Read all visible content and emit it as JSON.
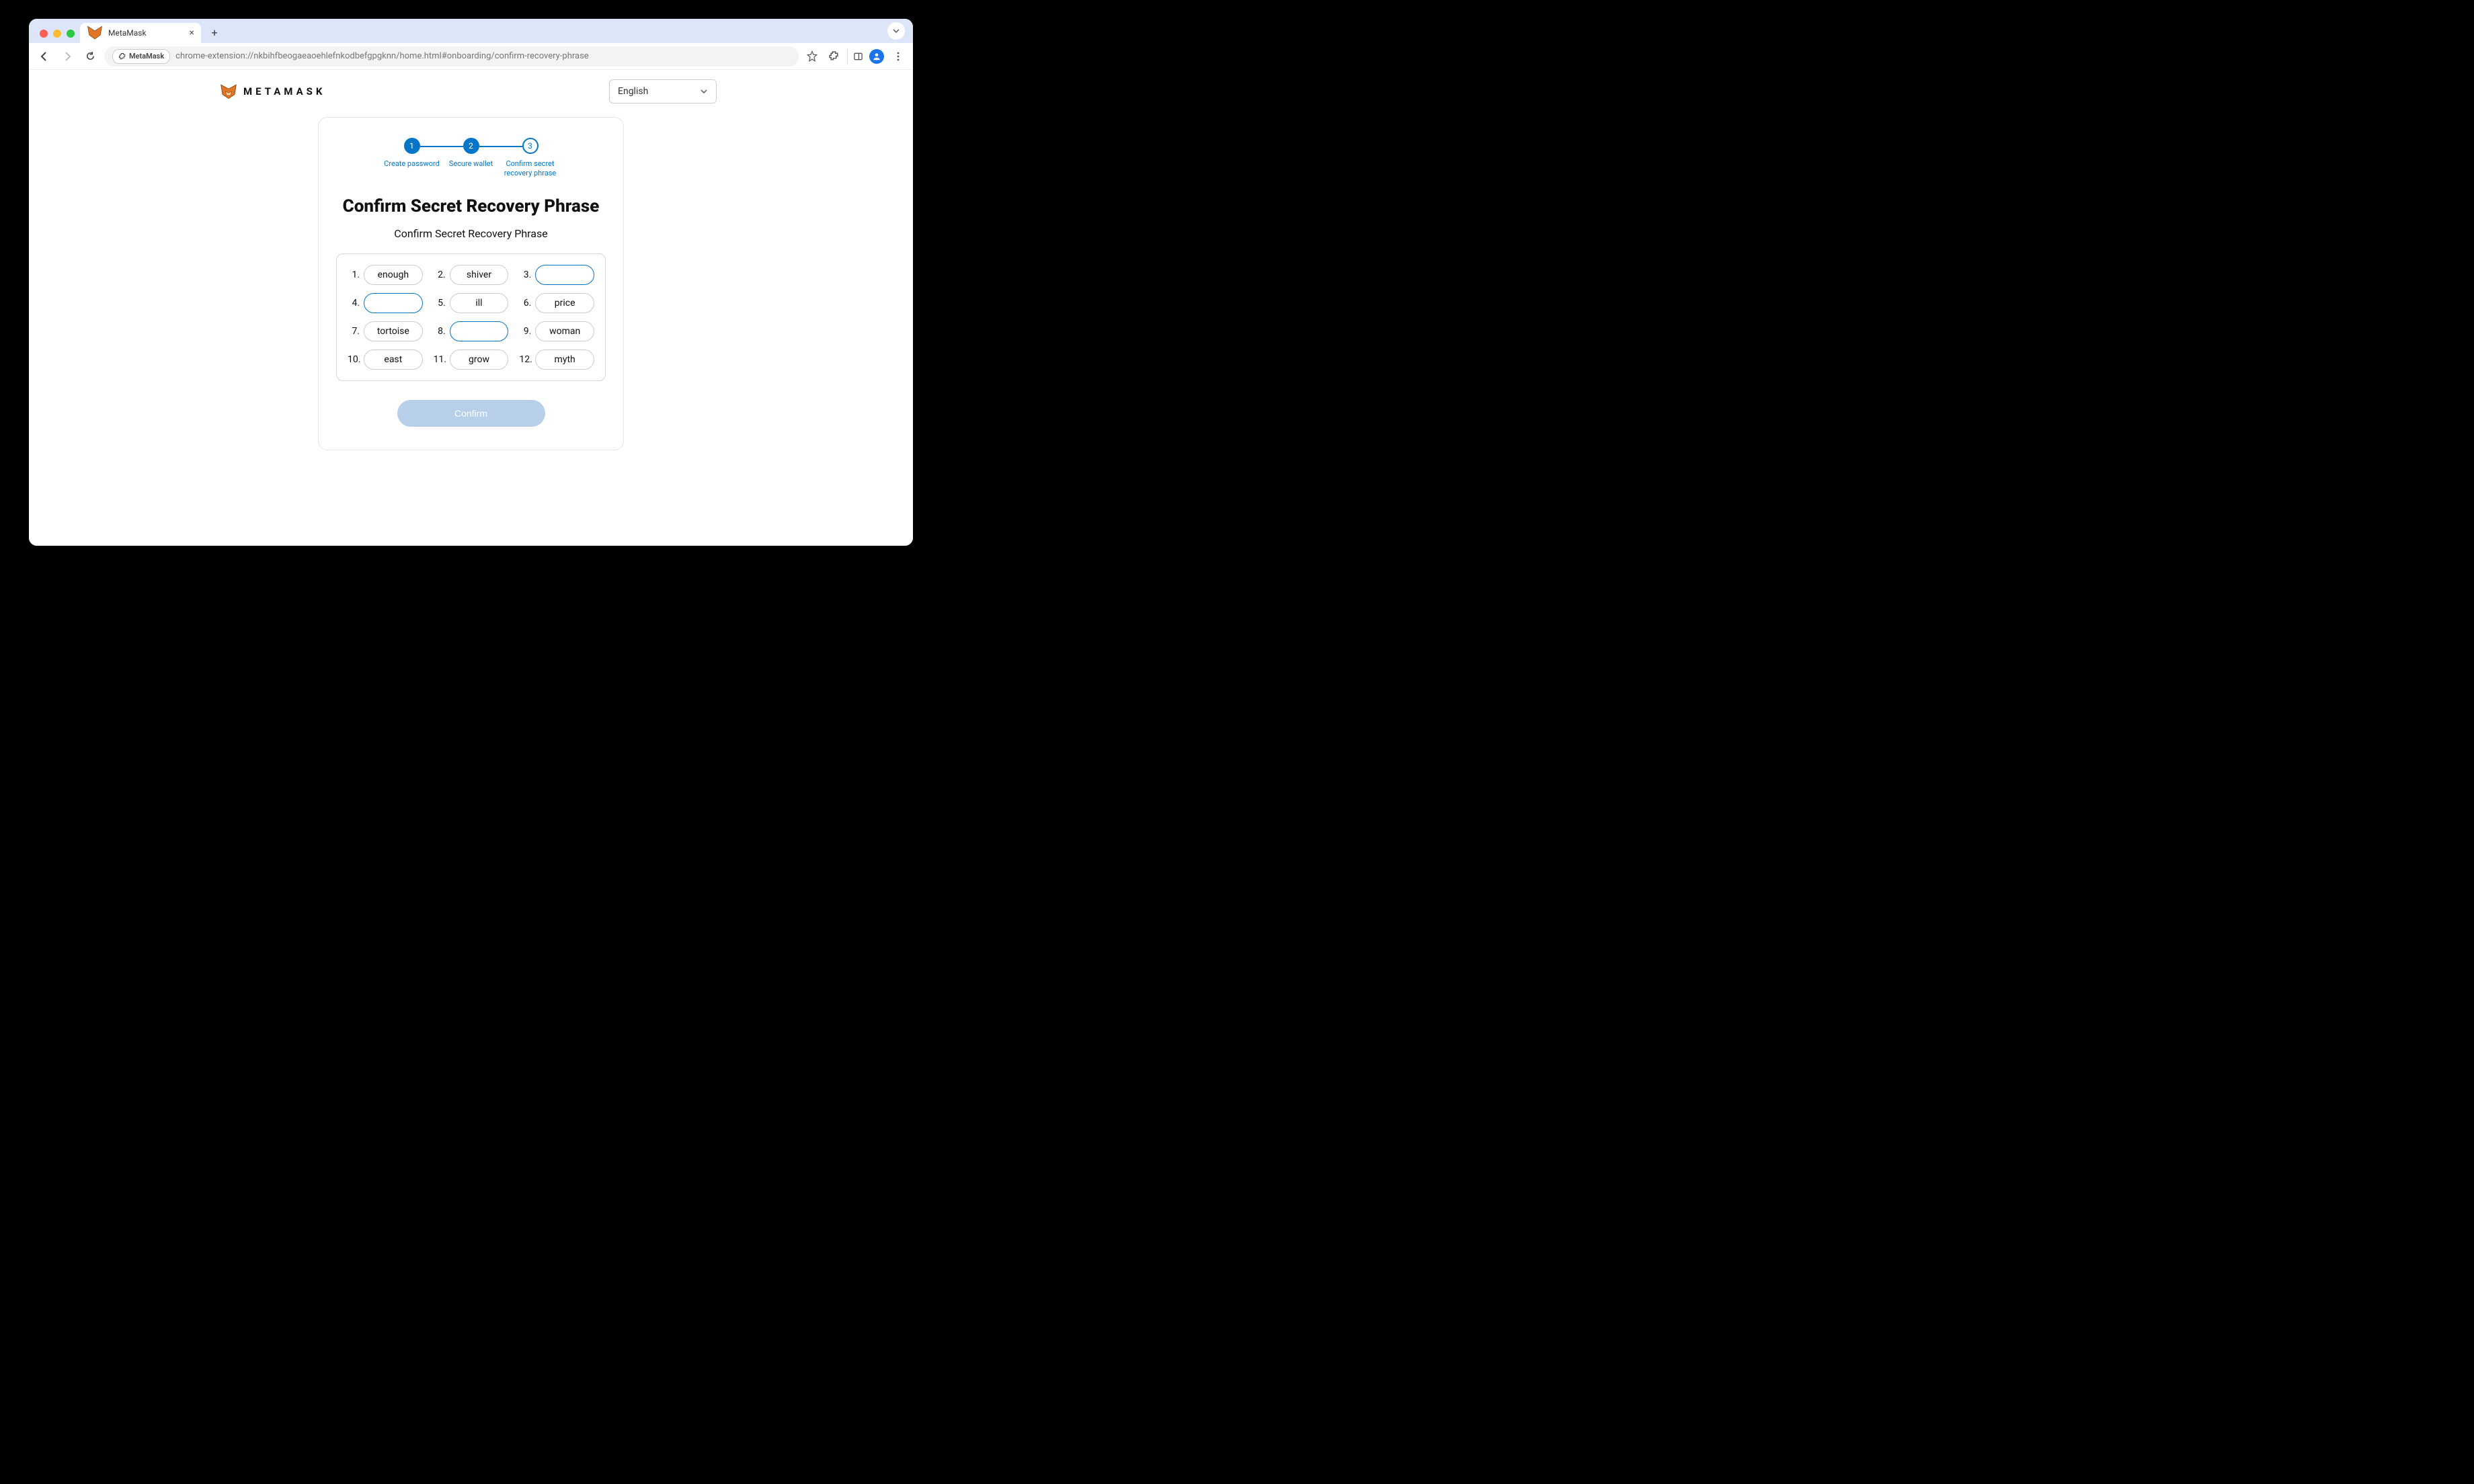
{
  "browser": {
    "tab_title": "MetaMask",
    "ext_chip_label": "MetaMask",
    "url": "chrome-extension://nkbihfbeogaeaoehlefnkodbefgpgknn/home.html#onboarding/confirm-recovery-phrase"
  },
  "header": {
    "brand_text": "METAMASK",
    "language": "English"
  },
  "stepper": {
    "steps": [
      {
        "num": "1",
        "label": "Create password"
      },
      {
        "num": "2",
        "label": "Secure wallet"
      },
      {
        "num": "3",
        "label": "Confirm secret recovery phrase"
      }
    ]
  },
  "card": {
    "title": "Confirm Secret Recovery Phrase",
    "subtitle": "Confirm Secret Recovery Phrase",
    "confirm_label": "Confirm"
  },
  "words": [
    {
      "n": "1.",
      "v": "enough",
      "editable": false
    },
    {
      "n": "2.",
      "v": "shiver",
      "editable": false
    },
    {
      "n": "3.",
      "v": "",
      "editable": true
    },
    {
      "n": "4.",
      "v": "",
      "editable": true
    },
    {
      "n": "5.",
      "v": "ill",
      "editable": false
    },
    {
      "n": "6.",
      "v": "price",
      "editable": false
    },
    {
      "n": "7.",
      "v": "tortoise",
      "editable": false
    },
    {
      "n": "8.",
      "v": "",
      "editable": true
    },
    {
      "n": "9.",
      "v": "woman",
      "editable": false
    },
    {
      "n": "10.",
      "v": "east",
      "editable": false
    },
    {
      "n": "11.",
      "v": "grow",
      "editable": false
    },
    {
      "n": "12.",
      "v": "myth",
      "editable": false
    }
  ]
}
